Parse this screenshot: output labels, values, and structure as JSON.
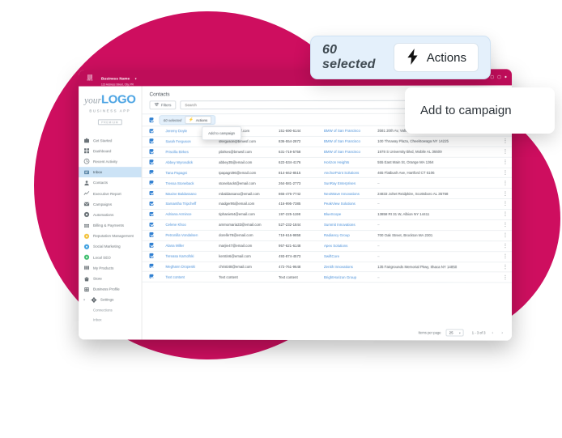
{
  "topbar": {
    "menu_icon": "menu-icon",
    "menu_label": "Menu",
    "business_name": "Business Name",
    "business_caret": "▾",
    "business_address": "123 Address Street, City, PR"
  },
  "sidebar": {
    "logo": {
      "prefix": "your",
      "main": "LOGO"
    },
    "subtitle": "BUSINESS APP",
    "badge": "PREMIUM",
    "items": [
      {
        "label": "Get Started",
        "icon": "briefcase-icon",
        "active": false
      },
      {
        "label": "Dashboard",
        "icon": "grid-icon",
        "active": false
      },
      {
        "label": "Recent Activity",
        "icon": "clock-icon",
        "active": false
      },
      {
        "label": "Inbox",
        "icon": "inbox-icon",
        "active": true
      },
      {
        "label": "Contacts",
        "icon": "person-icon",
        "active": false
      },
      {
        "label": "Executive Report",
        "icon": "chart-line-icon",
        "active": false
      },
      {
        "label": "Campaigns",
        "icon": "envelope-icon",
        "active": false
      },
      {
        "label": "Automations",
        "icon": "gear-circle-icon",
        "active": false
      },
      {
        "label": "Billing & Payments",
        "icon": "table-icon",
        "active": false
      },
      {
        "label": "Reputation Management",
        "icon": "yellow-circle-icon",
        "active": false
      },
      {
        "label": "Social Marketing",
        "icon": "blue-circle-icon",
        "active": false
      },
      {
        "label": "Local SEO",
        "icon": "green-circle-icon",
        "active": false
      },
      {
        "label": "My Products",
        "icon": "columns-icon",
        "active": false
      },
      {
        "label": "Store",
        "icon": "bag-icon",
        "active": false
      },
      {
        "label": "Business Profile",
        "icon": "building-icon",
        "active": false
      },
      {
        "label": "Settings",
        "icon": "gear-icon",
        "active": false,
        "expanded": true,
        "caret": "▾"
      }
    ],
    "sub_items": [
      {
        "label": "Connections"
      },
      {
        "label": "Inbox"
      }
    ]
  },
  "main": {
    "page_title": "Contacts",
    "filters_label": "Filters",
    "filters_icon": "filter-icon",
    "search_placeholder": "Search",
    "search_value": "",
    "search_icon": "search-icon",
    "selection": {
      "count_label": "60 selected",
      "actions_label": "Actions",
      "actions_icon": "bolt-icon"
    },
    "campaign_menu": {
      "item_label": "Add to campaign"
    },
    "table": {
      "rows": [
        {
          "checked": true,
          "name": "Jeremy Doyle",
          "email": "jdoyle@bmwsf.com",
          "phone": "151-690-6144",
          "company": "BMW of San Francisco",
          "address": "3581 20th Av, Valley AL 36854"
        },
        {
          "checked": true,
          "name": "Sarah Ferguson",
          "email": "sferguson@bmwsf.com",
          "phone": "836-554-2872",
          "company": "BMW of San Francisco",
          "address": "100 Thruway Plaza, Cheektowaga NY 14225"
        },
        {
          "checked": true,
          "name": "Priscilla Birkes",
          "email": "pbirkes@bmwsf.com",
          "phone": "631-719-5758",
          "company": "BMW of San Francisco",
          "address": "1978 S University Blvd, Mobile AL 36609"
        },
        {
          "checked": true,
          "name": "Abbey Wyrosdick",
          "email": "abbey35@email.com",
          "phone": "622-534-4176",
          "company": "Horizon Heights",
          "address": "555 East Main St, Orange MA 1364"
        },
        {
          "checked": true,
          "name": "Tana Papagni",
          "email": "tpapagni96@email.com",
          "phone": "814-662-8515",
          "company": "AnchorPoint Solutions",
          "address": "465 Flatbush Ave, Hartford CT 6106"
        },
        {
          "checked": true,
          "name": "Tressa Stoneback",
          "email": "stonebackt@email.com",
          "phone": "264-581-2773",
          "company": "SunRay Enterprises",
          "address": "–"
        },
        {
          "checked": true,
          "name": "Maxine Baldassano",
          "email": "mbaldassano@email.com",
          "phone": "865-476-7742",
          "company": "NextWave Innovations",
          "address": "24833 Johet Reidpkire, Scottsboro AL 35768"
        },
        {
          "checked": true,
          "name": "Samantha Tripcheff",
          "email": "madger95@email.com",
          "phone": "416-995-7385",
          "company": "PeakView Solutions",
          "address": "–"
        },
        {
          "checked": true,
          "name": "Adriana Armince",
          "email": "tiphanie54@email.com",
          "phone": "197-225-1198",
          "company": "BlueScope",
          "address": "13858 Rt 31 W, Albion NY 14411"
        },
        {
          "checked": true,
          "name": "Celene Khoo",
          "email": "ammomaria33@email.com",
          "phone": "527-232-1844",
          "company": "Summit Innovations",
          "address": "–"
        },
        {
          "checked": true,
          "name": "Petronilla Vondalsen",
          "email": "dorelle78@email.com",
          "phone": "719-616-9858",
          "company": "Radiancy Group",
          "address": "700 Oak Street, Brockton MA 2301"
        },
        {
          "checked": true,
          "name": "Alana Miller",
          "email": "marjie47@email.com",
          "phone": "957-621-6148",
          "company": "Apex Solutions",
          "address": "–"
        },
        {
          "checked": true,
          "name": "Tereasa Karnofski",
          "email": "kerstin6@email.com",
          "phone": "493-874-4573",
          "company": "SwiftCore",
          "address": "–"
        },
        {
          "checked": true,
          "name": "Meghann Dropeski",
          "email": "christi48@email.com",
          "phone": "472-761-9648",
          "company": "Zenith Innovations",
          "address": "135 Fairgrounds Memorial Pkwy, Ithaca NY 14850"
        },
        {
          "checked": true,
          "name": "Text content",
          "email": "Text content",
          "phone": "Text content",
          "company": "BrightHorizon Group",
          "address": "–"
        }
      ]
    },
    "footer": {
      "items_per_page_label": "Items per page",
      "items_per_page_value": "25",
      "items_per_page_caret": "▾",
      "range_text": "1 - 3 of 3",
      "prev_icon": "chevron-left-icon",
      "next_icon": "chevron-right-icon"
    }
  },
  "overlays": {
    "selection": {
      "count_label": "60 selected",
      "actions_label": "Actions",
      "actions_icon": "bolt-icon"
    },
    "campaign": {
      "label": "Add to campaign"
    }
  },
  "colors": {
    "brand_pink": "#CE0E5F",
    "logo_blue": "#4AA3E3",
    "link_blue": "#4A90D9",
    "checkbox_blue": "#2F7FD1",
    "selection_bg": "#E4F0FB"
  }
}
